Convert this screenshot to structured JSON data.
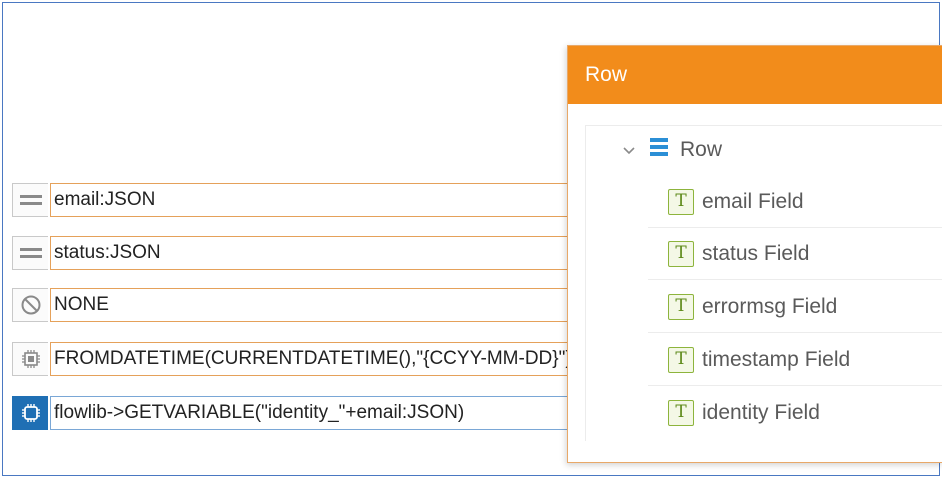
{
  "mappings": [
    {
      "icon": "equals-icon",
      "value": "email:JSON"
    },
    {
      "icon": "equals-icon",
      "value": "status:JSON"
    },
    {
      "icon": "prohibited-icon",
      "value": "NONE"
    },
    {
      "icon": "function-chip-icon",
      "value": "FROMDATETIME(CURRENTDATETIME(),\"{CCYY-MM-DD}\")"
    },
    {
      "icon": "function-chip-icon",
      "value": "flowlib->GETVARIABLE(\"identity_\"+email:JSON)"
    }
  ],
  "panel": {
    "title": "Row",
    "root_label": "Row",
    "icon_glyph": "T",
    "items": [
      {
        "label": "email Field"
      },
      {
        "label": "status Field"
      },
      {
        "label": "errormsg Field"
      },
      {
        "label": "timestamp Field"
      },
      {
        "label": "identity Field"
      }
    ]
  },
  "colors": {
    "accent_orange": "#f28c1b",
    "selected_blue": "#1f6fb4",
    "field_icon_green": "#8db43c"
  }
}
